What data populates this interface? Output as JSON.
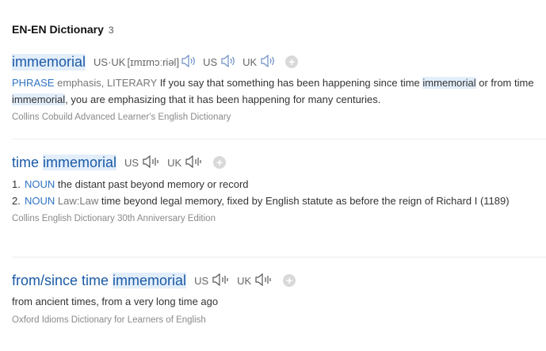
{
  "header": {
    "title": "EN-EN Dictionary",
    "count": "3"
  },
  "entries": [
    {
      "headword": "immemorial",
      "pron": {
        "usuk_label": "US·UK",
        "ipa": "[ɪmɪmɔːriəl]",
        "us_label": "US",
        "uk_label": "UK"
      },
      "def": {
        "pos": "PHRASE",
        "register": "emphasis, LITERARY",
        "t1": "If you say that something has been happening since time",
        "hl1": "immemorial",
        "t2": "or from time",
        "hl2": "immemorial",
        "t3": ", you are emphasizing that it has been happening for many centuries."
      },
      "source": "Collins Cobuild Advanced Learner's English Dictionary"
    },
    {
      "headword_pre": "time",
      "headword_hl": "immemorial",
      "pron": {
        "us_label": "US",
        "uk_label": "UK"
      },
      "senses": [
        {
          "num": "1.",
          "pos": "NOUN",
          "domain": "",
          "text": "the distant past beyond memory or record"
        },
        {
          "num": "2.",
          "pos": "NOUN",
          "domain": "Law:Law",
          "text": "time beyond legal memory, fixed by English statute as before the reign of Richard I (1189)"
        }
      ],
      "source": "Collins English Dictionary 30th Anniversary Edition"
    },
    {
      "headword_pre": "from/since time",
      "headword_hl": "immemorial",
      "pron": {
        "us_label": "US",
        "uk_label": "UK"
      },
      "text": "from ancient times, from a very long time ago",
      "source": "Oxford Idioms Dictionary for Learners of English"
    }
  ]
}
